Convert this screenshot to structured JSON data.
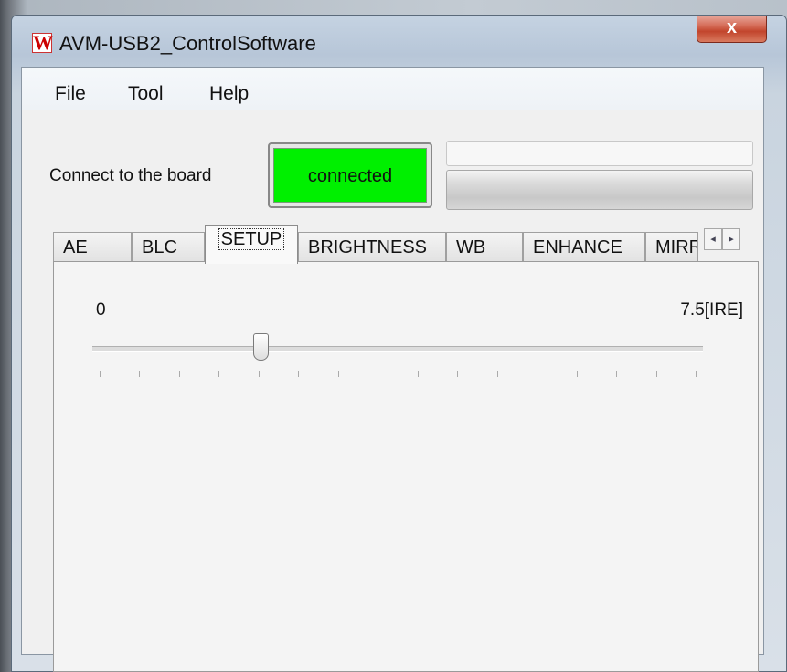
{
  "window": {
    "title": "AVM-USB2_ControlSoftware",
    "close_glyph": "x",
    "app_icon": {
      "name": "app-logo-icon",
      "glyph": "W",
      "color": "#cc0000"
    }
  },
  "menu": {
    "items": [
      {
        "label": "File"
      },
      {
        "label": "Tool"
      },
      {
        "label": "Help"
      }
    ]
  },
  "connection": {
    "label": "Connect to the board",
    "status": "connected",
    "status_color": "#00f000"
  },
  "tabs": {
    "items": [
      {
        "label": "AE"
      },
      {
        "label": "BLC"
      },
      {
        "label": "SETUP",
        "active": true
      },
      {
        "label": "BRIGHTNESS"
      },
      {
        "label": "WB"
      },
      {
        "label": "ENHANCE"
      },
      {
        "label": "MIRR"
      }
    ],
    "scroll_left": "◂",
    "scroll_right": "▸"
  },
  "setup_panel": {
    "min_label": "0",
    "max_label": "7.5[IRE]",
    "slider_value_fraction": 0.27,
    "tick_count": 16
  }
}
